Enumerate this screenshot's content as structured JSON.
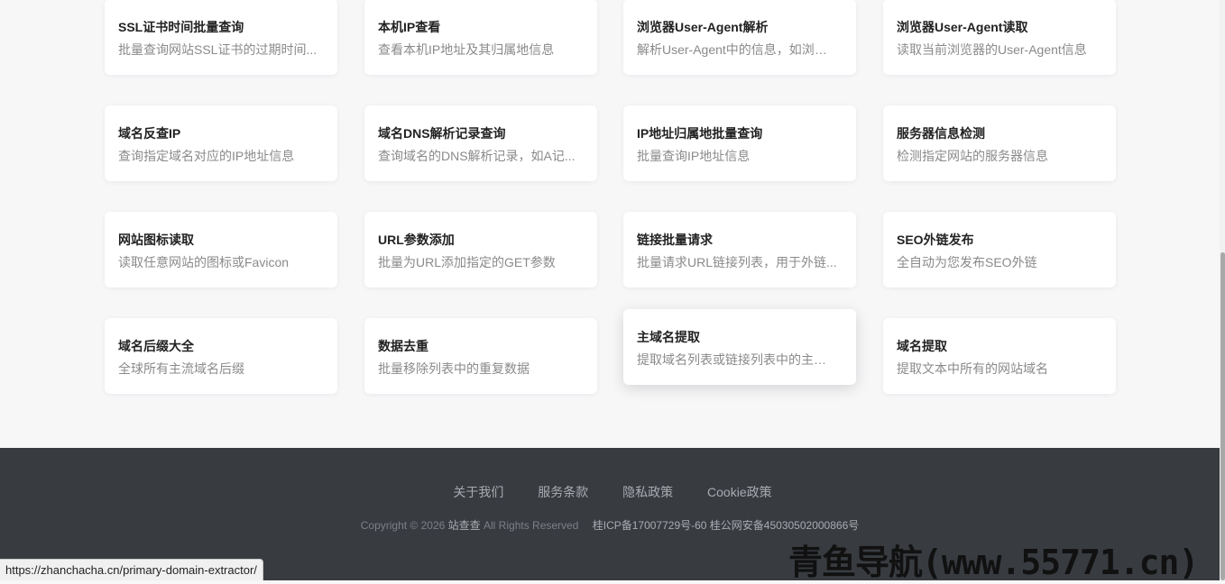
{
  "cards": [
    {
      "title": "SSL证书时间批量查询",
      "desc": "批量查询网站SSL证书的过期时间..."
    },
    {
      "title": "本机IP查看",
      "desc": "查看本机IP地址及其归属地信息"
    },
    {
      "title": "浏览器User-Agent解析",
      "desc": "解析User-Agent中的信息，如浏览..."
    },
    {
      "title": "浏览器User-Agent读取",
      "desc": "读取当前浏览器的User-Agent信息"
    },
    {
      "title": "域名反查IP",
      "desc": "查询指定域名对应的IP地址信息"
    },
    {
      "title": "域名DNS解析记录查询",
      "desc": "查询域名的DNS解析记录，如A记..."
    },
    {
      "title": "IP地址归属地批量查询",
      "desc": "批量查询IP地址信息"
    },
    {
      "title": "服务器信息检测",
      "desc": "检测指定网站的服务器信息"
    },
    {
      "title": "网站图标读取",
      "desc": "读取任意网站的图标或Favicon"
    },
    {
      "title": "URL参数添加",
      "desc": "批量为URL添加指定的GET参数"
    },
    {
      "title": "链接批量请求",
      "desc": "批量请求URL链接列表，用于外链..."
    },
    {
      "title": "SEO外链发布",
      "desc": "全自动为您发布SEO外链"
    },
    {
      "title": "域名后缀大全",
      "desc": "全球所有主流域名后缀"
    },
    {
      "title": "数据去重",
      "desc": "批量移除列表中的重复数据"
    },
    {
      "title": "主域名提取",
      "desc": "提取域名列表或链接列表中的主域名"
    },
    {
      "title": "域名提取",
      "desc": "提取文本中所有的网站域名"
    }
  ],
  "footer": {
    "links": [
      "关于我们",
      "服务条款",
      "隐私政策",
      "Cookie政策"
    ],
    "copyright_prefix": "Copyright © 2026",
    "brand": "站查查",
    "rights": "All Rights Reserved",
    "icp": "桂ICP备17007729号-60 桂公网安备45030502000866号"
  },
  "status_url": "https://zhanchacha.cn/primary-domain-extractor/",
  "watermark": "青鱼导航(www.55771.cn)",
  "colors": {
    "footer_bg": "#383c41",
    "card_bg": "#ffffff",
    "page_bg": "#f7f7f8"
  }
}
